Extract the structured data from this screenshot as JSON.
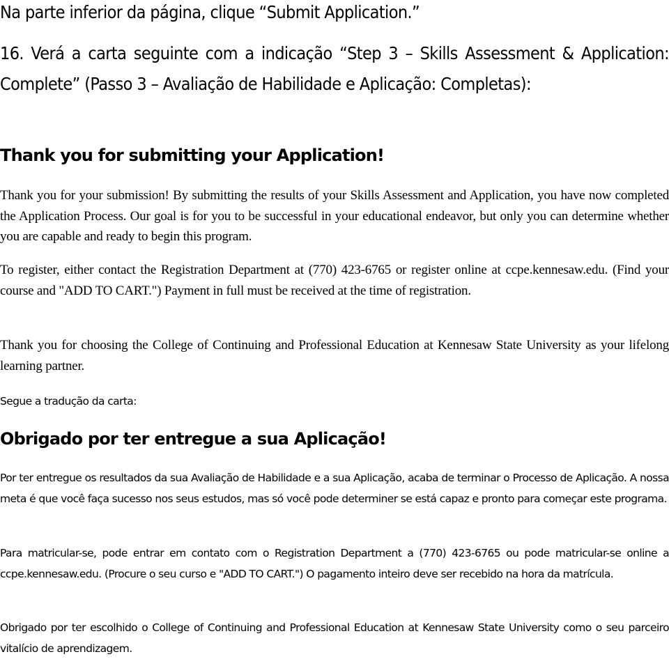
{
  "instruction": "Na parte inferior da página, clique “Submit Application.”",
  "step16": "16. Verá a carta seguinte com a indicação “Step 3 – Skills Assessment & Application: Complete” (Passo 3 – Avaliação de Habilidade e Aplicação: Completas):",
  "letter_en": {
    "heading": "Thank you for submitting your Application!",
    "paragraphs": [
      "Thank you for your submission! By submitting the results of your Skills Assessment and Application, you have now completed the Application Process. Our goal is for you to be successful in your educational endeavor, but only you can determine whether you are capable and ready to begin this program.",
      "To register, either contact the Registration Department at (770) 423-6765 or register online at ccpe.kennesaw.edu. (Find your course and \"ADD TO CART.\") Payment in full must be received at the time of registration.",
      "Thank you for choosing the College of Continuing and Professional Education at Kennesaw State University as your lifelong learning partner."
    ]
  },
  "translation_label": "Segue a tradução da carta:",
  "letter_pt": {
    "heading": "Obrigado por ter entregue a sua Aplicação!",
    "paragraphs": [
      "Por ter entregue os resultados da sua Avaliação de Habilidade e a sua Aplicação, acaba de terminar o Processo de Aplicação. A nossa meta é que você faça sucesso nos seus estudos, mas só você pode determiner se está capaz e pronto para começar este programa.",
      "Para matricular-se, pode entrar em contato com o Registration Department a (770) 423-6765 ou pode matricular-se online a ccpe.kennesaw.edu. (Procure o seu curso e \"ADD TO CART.\") O pagamento inteiro deve ser recebido na hora da matrícula.",
      "Obrigado por ter escolhido o College of Continuing and Professional Education at Kennesaw State University como o seu parceiro vitalício de aprendizagem."
    ]
  }
}
